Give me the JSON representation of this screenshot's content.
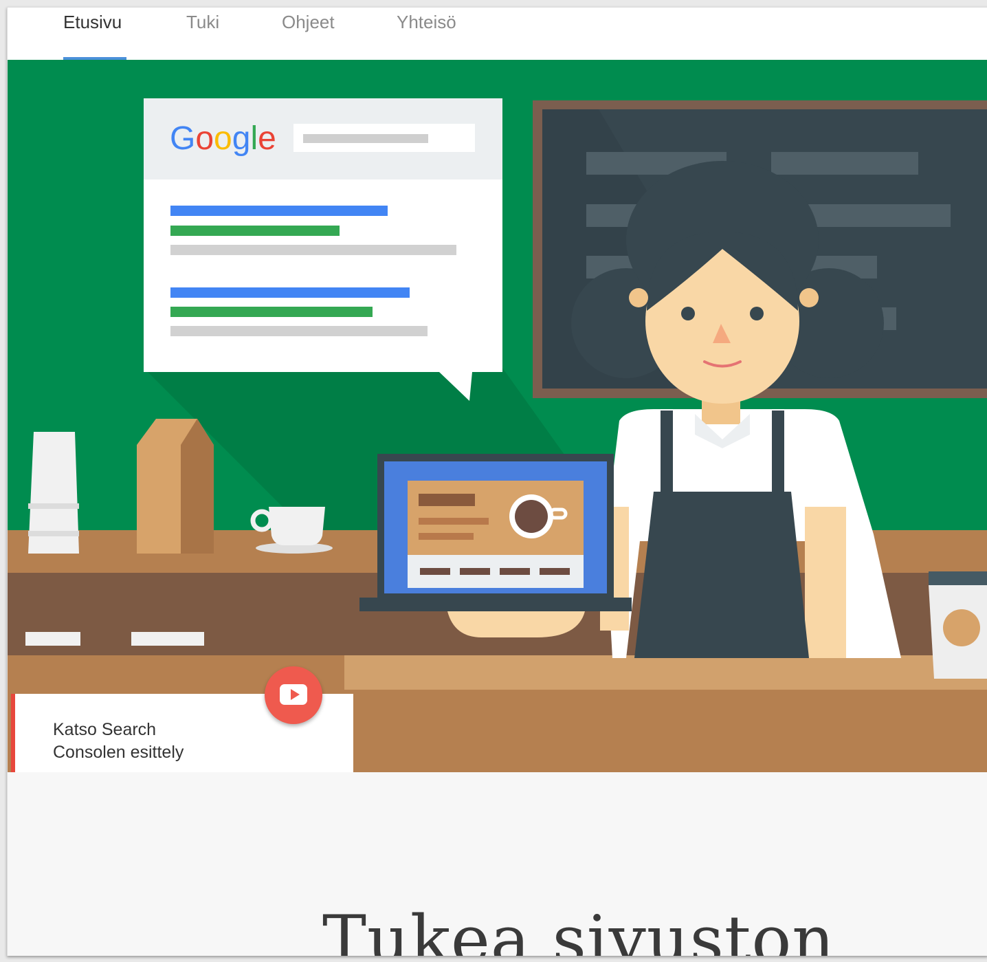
{
  "nav": {
    "tabs": [
      {
        "label": "Etusivu",
        "active": true
      },
      {
        "label": "Tuki",
        "active": false
      },
      {
        "label": "Ohjeet",
        "active": false
      },
      {
        "label": "Yhteisö",
        "active": false
      }
    ]
  },
  "hero": {
    "search_logo_text": "Google",
    "video_card": {
      "line1": "Katso Search",
      "line2": "Consolen esittely",
      "icon": "youtube-play-icon"
    }
  },
  "main": {
    "headline": "Tukea sivuston"
  },
  "colors": {
    "green_wall": "#008c4f",
    "counter": "#b58050",
    "counter_dark": "#7d5a44",
    "play_red": "#ef5a4e",
    "tab_indicator": "#4a90d9"
  }
}
